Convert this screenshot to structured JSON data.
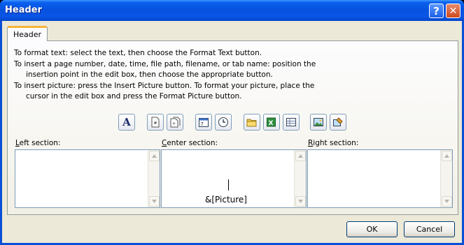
{
  "window": {
    "title": "Header",
    "help_label": "?",
    "close_label": "✕"
  },
  "tabs": [
    {
      "label": "Header"
    }
  ],
  "instructions": [
    {
      "text": "To format text:  select the text, then choose the Format Text button.",
      "indent": false
    },
    {
      "text": "To insert a page number, date, time, file path, filename, or tab name:  position the",
      "indent": false
    },
    {
      "text": "insertion point in the edit box, then choose the appropriate button.",
      "indent": true
    },
    {
      "text": "To insert picture: press the Insert Picture button.  To format your picture, place the",
      "indent": false
    },
    {
      "text": "cursor in the edit box and press the Format Picture button.",
      "indent": true
    }
  ],
  "toolbar": {
    "buttons": [
      {
        "icon": "format-text-icon",
        "glyph": "A"
      },
      {
        "icon": "insert-page-number-icon"
      },
      {
        "icon": "insert-number-of-pages-icon"
      },
      {
        "icon": "insert-date-icon"
      },
      {
        "icon": "insert-time-icon"
      },
      {
        "icon": "insert-file-path-icon"
      },
      {
        "icon": "insert-file-name-icon"
      },
      {
        "icon": "insert-sheet-name-icon"
      },
      {
        "icon": "insert-picture-icon"
      },
      {
        "icon": "format-picture-icon"
      }
    ]
  },
  "sections": {
    "left": {
      "label_pre": "",
      "label_ul": "L",
      "label_post": "eft section:",
      "value": ""
    },
    "center": {
      "label_pre": "",
      "label_ul": "C",
      "label_post": "enter section:",
      "value": "&[Picture]"
    },
    "right": {
      "label_pre": "",
      "label_ul": "R",
      "label_post": "ight section:",
      "value": ""
    }
  },
  "buttons": {
    "ok": "OK",
    "cancel": "Cancel"
  }
}
